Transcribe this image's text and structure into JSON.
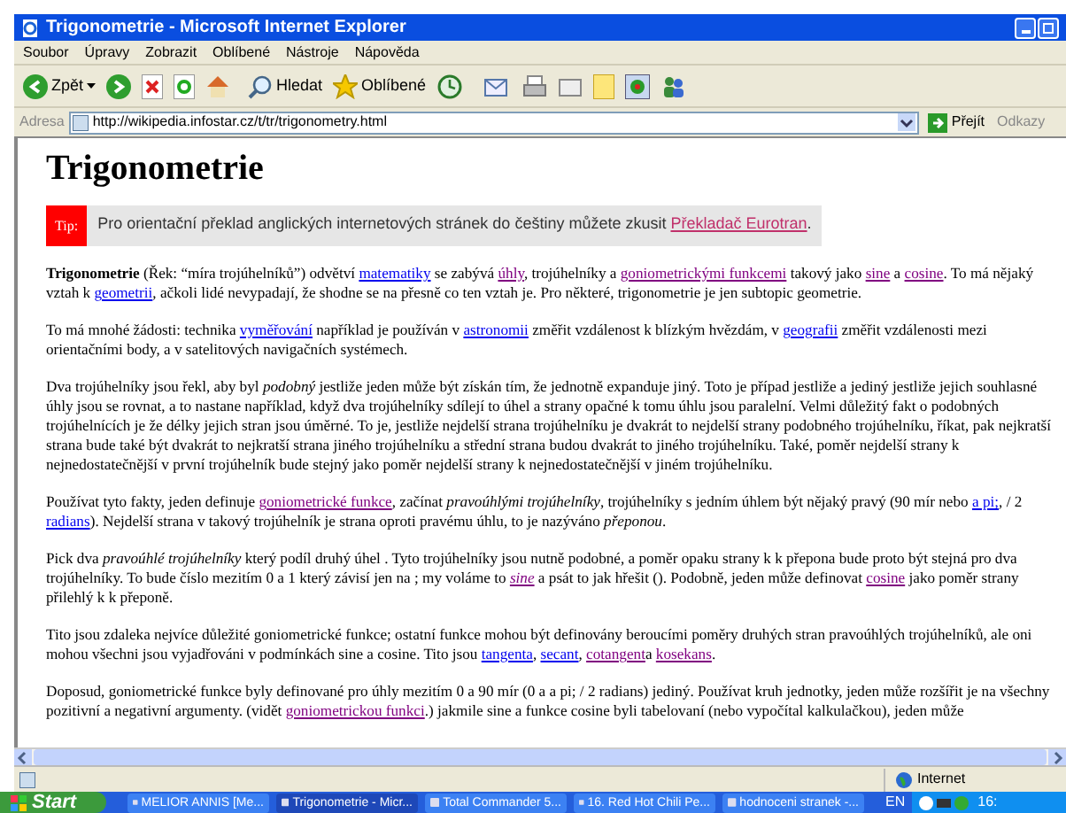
{
  "window": {
    "title": "Trigonometrie - Microsoft Internet Explorer"
  },
  "menu": [
    "Soubor",
    "Úpravy",
    "Zobrazit",
    "Oblíbené",
    "Nástroje",
    "Nápověda"
  ],
  "toolbar": {
    "back": "Zpět",
    "search": "Hledat",
    "favorites": "Oblíbené"
  },
  "address_bar": {
    "label": "Adresa",
    "value": "http://wikipedia.infostar.cz/t/tr/trigonometry.html",
    "go": "Přejít",
    "links": "Odkazy"
  },
  "page": {
    "heading": "Trigonometrie",
    "tip": {
      "label": "Tip:",
      "runs": [
        {
          "kind": "text",
          "text": "Pro orientační překlad anglických internetových stránek do češtiny můžete zkusit "
        },
        {
          "kind": "link",
          "text": "Překladač Eurotran",
          "visited": true,
          "italic": false
        },
        {
          "kind": "text",
          "text": "."
        }
      ]
    },
    "paragraphs": [
      [
        {
          "kind": "bold",
          "text": "Trigonometrie"
        },
        {
          "kind": "text",
          "text": " (Řek: “míra trojúhelníků”) odvětví "
        },
        {
          "kind": "link",
          "text": "matematiky",
          "visited": false,
          "italic": false
        },
        {
          "kind": "text",
          "text": " se zabývá "
        },
        {
          "kind": "link",
          "text": "úhly",
          "visited": true,
          "italic": false
        },
        {
          "kind": "text",
          "text": ", trojúhelníky a "
        },
        {
          "kind": "link",
          "text": "goniometrickými funkcemi",
          "visited": true,
          "italic": false
        },
        {
          "kind": "text",
          "text": " takový jako "
        },
        {
          "kind": "link",
          "text": "sine",
          "visited": true,
          "italic": false
        },
        {
          "kind": "text",
          "text": " a "
        },
        {
          "kind": "link",
          "text": "cosine",
          "visited": true,
          "italic": false
        },
        {
          "kind": "text",
          "text": ". To má nějaký vztah k "
        },
        {
          "kind": "link",
          "text": "geometrii",
          "visited": false,
          "italic": false
        },
        {
          "kind": "text",
          "text": ", ačkoli lidé nevypadají, že shodne se na přesně co ten vztah je. Pro některé, trigonometrie je jen subtopic geometrie."
        }
      ],
      [
        {
          "kind": "text",
          "text": "To má mnohé žádosti: technika "
        },
        {
          "kind": "link",
          "text": "vyměřování",
          "visited": false,
          "italic": false
        },
        {
          "kind": "text",
          "text": " například je používán v "
        },
        {
          "kind": "link",
          "text": "astronomii",
          "visited": false,
          "italic": false
        },
        {
          "kind": "text",
          "text": " změřit vzdálenost k blízkým hvězdám, v "
        },
        {
          "kind": "link",
          "text": "geografii",
          "visited": false,
          "italic": false
        },
        {
          "kind": "text",
          "text": " změřit vzdálenosti mezi orientačními body, a v satelitových navigačních systémech."
        }
      ],
      [
        {
          "kind": "text",
          "text": "Dva trojúhelníky jsou řekl, aby byl "
        },
        {
          "kind": "italic",
          "text": "podobný"
        },
        {
          "kind": "text",
          "text": " jestliže jeden může být získán tím, že jednotně expanduje jiný. Toto je případ jestliže a jediný jestliže jejich souhlasné úhly jsou se rovnat, a to nastane například, když dva trojúhelníky sdílejí to úhel a strany opačné k tomu úhlu jsou paralelní. Velmi důležitý fakt o podobných trojúhelnících je že délky jejich stran jsou úměrné. To je, jestliže nejdelší strana trojúhelníku je dvakrát to nejdelší strany podobného trojúhelníku, říkat, pak nejkratší strana bude také být dvakrát to nejkratší strana jiného trojúhelníku a střední strana budou dvakrát to jiného trojúhelníku. Také, poměr nejdelší strany k nejnedostatečnější v první trojúhelník bude stejný jako poměr nejdelší strany k nejnedostatečnější v jiném trojúhelníku."
        }
      ],
      [
        {
          "kind": "text",
          "text": "Používat tyto fakty, jeden definuje "
        },
        {
          "kind": "link",
          "text": "goniometrické funkce",
          "visited": true,
          "italic": false
        },
        {
          "kind": "text",
          "text": ", začínat "
        },
        {
          "kind": "italic",
          "text": "pravoúhlými trojúhelníky"
        },
        {
          "kind": "text",
          "text": ", trojúhelníky s jedním úhlem být nějaký pravý (90 mír nebo "
        },
        {
          "kind": "link",
          "text": "a pi;",
          "visited": false,
          "italic": false
        },
        {
          "kind": "text",
          "text": ", / 2 "
        },
        {
          "kind": "link",
          "text": "radians",
          "visited": false,
          "italic": false
        },
        {
          "kind": "text",
          "text": "). Nejdelší strana v takový trojúhelník je strana oproti pravému úhlu, to je nazýváno "
        },
        {
          "kind": "italic",
          "text": "přeponou"
        },
        {
          "kind": "text",
          "text": "."
        }
      ],
      [
        {
          "kind": "text",
          "text": "Pick dva "
        },
        {
          "kind": "italic",
          "text": "pravoúhlé trojúhelníky"
        },
        {
          "kind": "text",
          "text": " který podíl druhý úhel . Tyto trojúhelníky jsou nutně podobné, a poměr opaku strany k k přepona bude proto být stejná pro dva trojúhelníky. To bude číslo mezitím 0 a 1 který závisí jen na ; my voláme to "
        },
        {
          "kind": "link",
          "text": "sine",
          "visited": true,
          "italic": true
        },
        {
          "kind": "text",
          "text": " a psát to jak hřešit (). Podobně, jeden může definovat "
        },
        {
          "kind": "link",
          "text": "cosine",
          "visited": true,
          "italic": false
        },
        {
          "kind": "text",
          "text": " jako poměr strany přilehlý k k přeponě."
        }
      ],
      [
        {
          "kind": "text",
          "text": "Tito jsou zdaleka nejvíce důležité goniometrické funkce; ostatní funkce mohou být definovány beroucími poměry druhých stran pravoúhlých trojúhelníků, ale oni mohou všechni jsou vyjadřováni v podmínkách sine a cosine. Tito jsou "
        },
        {
          "kind": "link",
          "text": "tangenta",
          "visited": false,
          "italic": false
        },
        {
          "kind": "text",
          "text": ", "
        },
        {
          "kind": "link",
          "text": "secant",
          "visited": false,
          "italic": false
        },
        {
          "kind": "text",
          "text": ", "
        },
        {
          "kind": "link",
          "text": "cotangent",
          "visited": true,
          "italic": false
        },
        {
          "kind": "text",
          "text": "a "
        },
        {
          "kind": "link",
          "text": "kosekans",
          "visited": true,
          "italic": false
        },
        {
          "kind": "text",
          "text": "."
        }
      ],
      [
        {
          "kind": "text",
          "text": "Doposud, goniometrické funkce byly definované pro úhly mezitím 0 a 90 mír (0 a a pi; / 2 radians) jediný. Používat kruh jednotky, jeden může rozšířit je na všechny pozitivní a negativní argumenty. (vidět "
        },
        {
          "kind": "link",
          "text": "goniometrickou funkci",
          "visited": true,
          "italic": false
        },
        {
          "kind": "text",
          "text": ".) jakmile sine a funkce cosine byli tabelovaní (nebo vypočítal kalkulačkou), jeden může"
        }
      ]
    ]
  },
  "status_bar": {
    "zone": "Internet"
  },
  "taskbar": {
    "start": "Start",
    "items": [
      {
        "label": "MELIOR ANNIS [Me...",
        "selected": false
      },
      {
        "label": "Trigonometrie - Micr...",
        "selected": true
      },
      {
        "label": "Total Commander 5...",
        "selected": false
      },
      {
        "label": "16. Red Hot Chili Pe...",
        "selected": false
      },
      {
        "label": "hodnoceni stranek -...",
        "selected": false
      }
    ],
    "language": "EN",
    "clock": "16:"
  }
}
